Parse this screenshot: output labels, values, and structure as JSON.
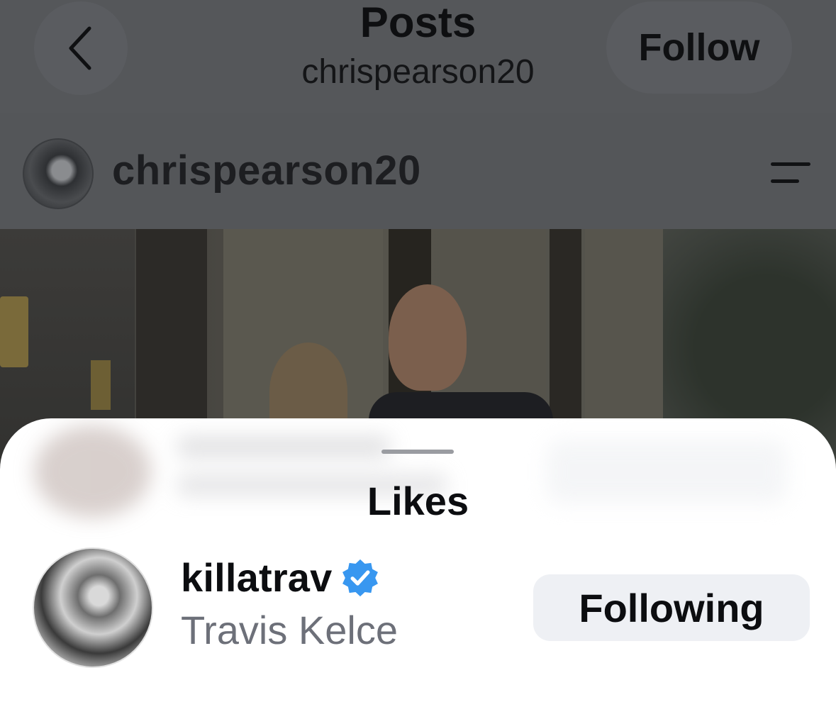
{
  "header": {
    "title": "Posts",
    "subtitle": "chrispearson20",
    "follow_label": "Follow"
  },
  "post": {
    "author_username": "chrispearson20"
  },
  "likes_sheet": {
    "title": "Likes",
    "likers": [
      {
        "username": "killatrav",
        "verified": true,
        "full_name": "Travis Kelce",
        "follow_state_label": "Following"
      }
    ]
  },
  "colors": {
    "verified_badge": "#3897f0",
    "following_button_bg": "#eef0f4",
    "dim_overlay": "#545659"
  },
  "icons": [
    "chevron-left-icon",
    "menu-icon",
    "verified-badge-icon"
  ]
}
